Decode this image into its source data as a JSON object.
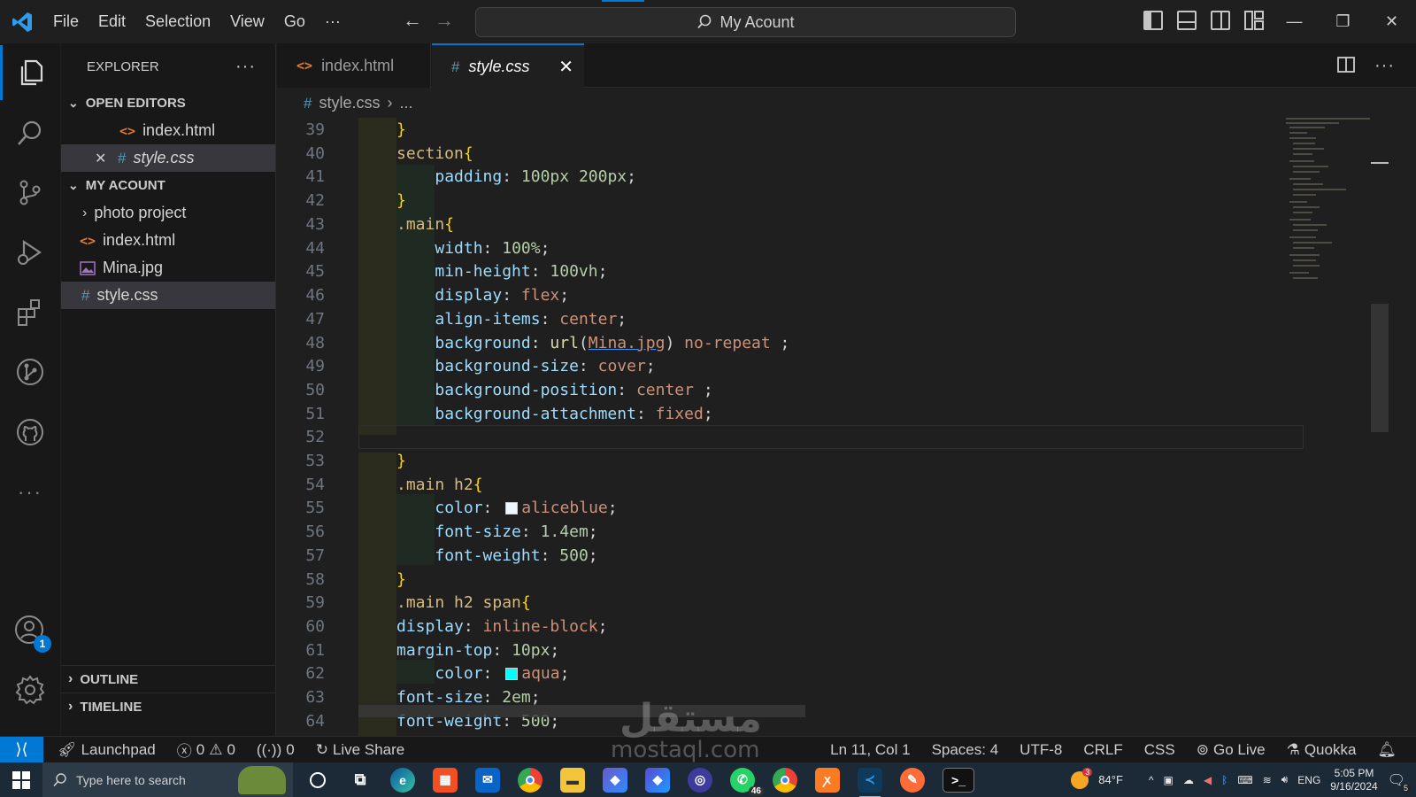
{
  "titlebar": {
    "menu": [
      "File",
      "Edit",
      "Selection",
      "View",
      "Go",
      "···"
    ],
    "search_text": "My Acount",
    "window_controls": [
      "minimize",
      "restore",
      "close"
    ]
  },
  "sidebar": {
    "header": "EXPLORER",
    "open_editors_label": "OPEN EDITORS",
    "open_editors": [
      {
        "name": "index.html",
        "type": "html"
      },
      {
        "name": "style.css",
        "type": "css"
      }
    ],
    "folder_label": "MY ACOUNT",
    "files": [
      {
        "name": "photo project",
        "type": "folder"
      },
      {
        "name": "index.html",
        "type": "html"
      },
      {
        "name": "Mina.jpg",
        "type": "image"
      },
      {
        "name": "style.css",
        "type": "css"
      }
    ],
    "outline_label": "OUTLINE",
    "timeline_label": "TIMELINE"
  },
  "tabs": [
    {
      "label": "index.html",
      "active": false
    },
    {
      "label": "style.css",
      "active": true
    }
  ],
  "breadcrumb": {
    "file": "style.css",
    "rest": "..."
  },
  "editor": {
    "lines": [
      {
        "n": "39"
      },
      {
        "n": "40"
      },
      {
        "n": "41"
      },
      {
        "n": "42"
      },
      {
        "n": "43"
      },
      {
        "n": "44"
      },
      {
        "n": "45"
      },
      {
        "n": "46"
      },
      {
        "n": "47"
      },
      {
        "n": "48"
      },
      {
        "n": "49"
      },
      {
        "n": "50"
      },
      {
        "n": "51"
      },
      {
        "n": "52"
      },
      {
        "n": "53"
      },
      {
        "n": "54"
      },
      {
        "n": "55"
      },
      {
        "n": "56"
      },
      {
        "n": "57"
      },
      {
        "n": "58"
      },
      {
        "n": "59"
      },
      {
        "n": "60"
      },
      {
        "n": "61"
      },
      {
        "n": "62"
      },
      {
        "n": "63"
      },
      {
        "n": "64"
      }
    ],
    "swatch_aliceblue": "#f0f8ff",
    "swatch_aqua": "#00ffff"
  },
  "statusbar": {
    "launchpad": "Launchpad",
    "errors": "0",
    "warnings": "0",
    "ports": "0",
    "live_share": "Live Share",
    "position": "Ln 11, Col 1",
    "spaces": "Spaces: 4",
    "encoding": "UTF-8",
    "eol": "CRLF",
    "language": "CSS",
    "go_live": "Go Live",
    "quokka": "Quokka"
  },
  "taskbar": {
    "search_placeholder": "Type here to search",
    "weather": "84°F",
    "weather_badge": "3",
    "lang": "ENG",
    "time": "5:05 PM",
    "date": "9/16/2024",
    "notification_count": "5",
    "whatsapp_badge": "46"
  },
  "accounts_badge": "1",
  "watermark": {
    "arabic": "مستقل",
    "latin": "mostaql.com"
  },
  "colors": {
    "accent": "#0078d4",
    "editor_bg": "#1f1f1f",
    "sidebar_bg": "#181818"
  }
}
